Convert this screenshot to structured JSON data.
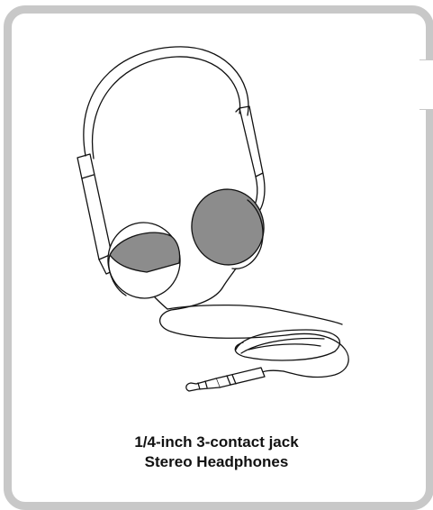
{
  "caption": {
    "line1": "1/4-inch 3-contact jack",
    "line2": "Stereo Headphones"
  },
  "colors": {
    "frame": "#c8c8c8",
    "earpad": "#8c8c8c",
    "line": "#111111"
  }
}
